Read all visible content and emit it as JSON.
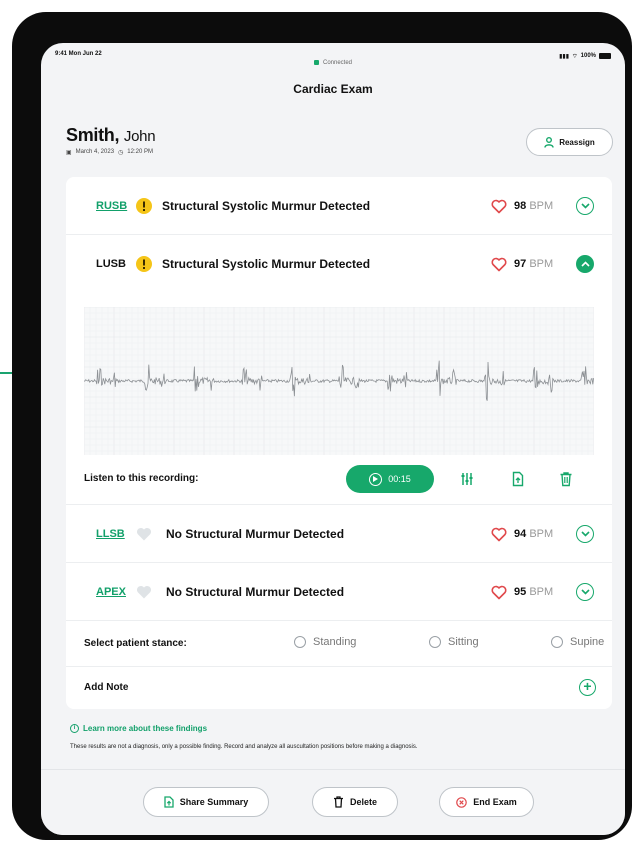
{
  "status_bar": {
    "time": "9:41 Mon Jun 22",
    "battery": "100%"
  },
  "connection": {
    "label": "Connected"
  },
  "header": {
    "title": "Cardiac Exam"
  },
  "patient": {
    "last_name": "Smith,",
    "first_name": "John",
    "date": "March 4, 2023",
    "time": "12:20 PM"
  },
  "reassign": {
    "label": "Reassign"
  },
  "rows": [
    {
      "location": "RUSB",
      "finding": "Structural Systolic Murmur Detected",
      "bpm": "98",
      "unit": "BPM",
      "status": "warning",
      "expanded": false
    },
    {
      "location": "LUSB",
      "finding": "Structural Systolic Murmur Detected",
      "bpm": "97",
      "unit": "BPM",
      "status": "warning",
      "expanded": true
    },
    {
      "location": "LLSB",
      "finding": "No Structural Murmur Detected",
      "bpm": "94",
      "unit": "BPM",
      "status": "normal",
      "expanded": false
    },
    {
      "location": "APEX",
      "finding": "No Structural Murmur Detected",
      "bpm": "95",
      "unit": "BPM",
      "status": "normal",
      "expanded": false
    }
  ],
  "recording": {
    "label": "Listen to this recording:",
    "duration": "00:15"
  },
  "stance": {
    "label": "Select patient stance:",
    "options": [
      "Standing",
      "Sitting",
      "Supine"
    ]
  },
  "note": {
    "label": "Add Note"
  },
  "info": {
    "learn_more": "Learn more about these findings",
    "disclaimer": "These results are not a diagnosis, only a possible finding. Record and analyze all auscultation positions before making a diagnosis."
  },
  "footer": {
    "share": "Share Summary",
    "delete": "Delete",
    "end": "End Exam"
  },
  "colors": {
    "accent": "#17a86b",
    "warning": "#f5c518",
    "heart": "#e0484b",
    "normal_marker": "#dfe3e6"
  }
}
